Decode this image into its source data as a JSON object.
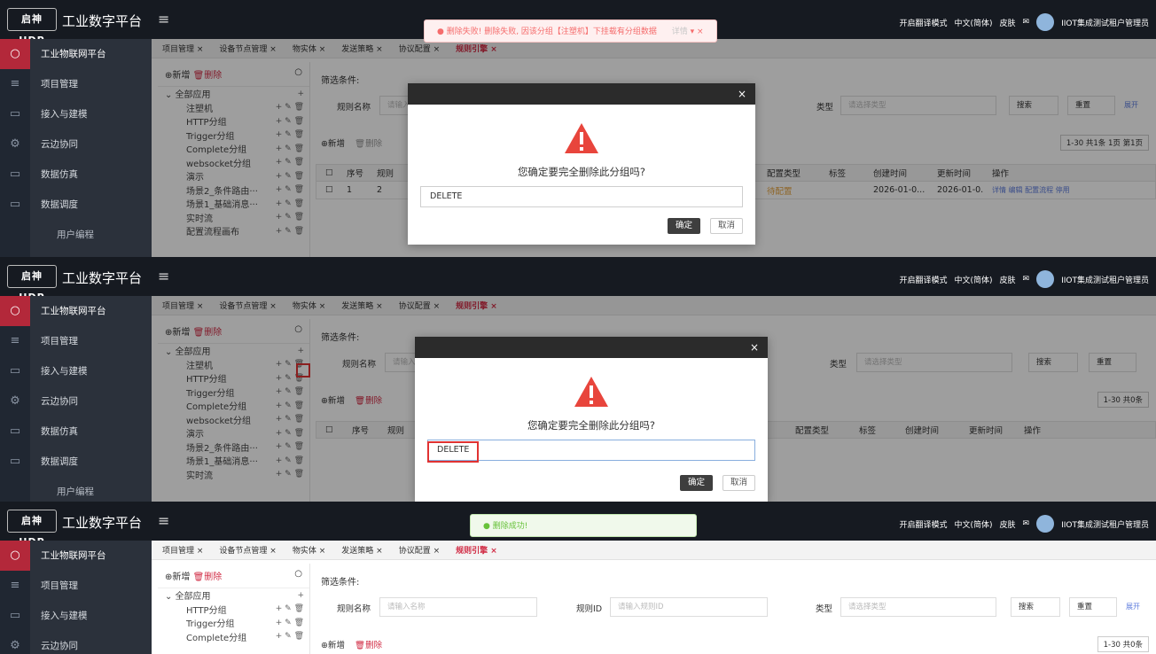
{
  "app": {
    "logo_text": "启神 IIDP",
    "title": "工业数字平台",
    "menu_icon": "hamburger-icon"
  },
  "header_right": {
    "translate_mode": "开启翻译模式",
    "language": "中文(简体)",
    "skin": "皮肤",
    "user": "IIOT集成测试租户管理员"
  },
  "sidebar": {
    "platform": "工业物联网平台",
    "items": [
      "项目管理",
      "接入与建模",
      "云边协同",
      "数据仿真",
      "数据调度"
    ],
    "sub_items": [
      "用户编程"
    ]
  },
  "tabs": [
    "项目管理",
    "设备节点管理",
    "物实体",
    "发送策略",
    "协议配置",
    "规则引擎"
  ],
  "active_tab": "规则引擎",
  "tree": {
    "add": "新增",
    "delete": "删除",
    "root": "全部应用",
    "nodes_before": [
      "注塑机",
      "HTTP分组",
      "Trigger分组",
      "Complete分组",
      "websocket分组",
      "演示",
      "场景2_条件路由···",
      "场景1_基础消息···",
      "实时流",
      "配置流程画布"
    ],
    "nodes_after": [
      "HTTP分组",
      "Trigger分组",
      "Complete分组"
    ]
  },
  "filter": {
    "label": "筛选条件:",
    "rule_name": "规则名称",
    "rule_name_ph": "请输入名称",
    "rule_id": "规则ID",
    "rule_id_ph": "请输入规则ID",
    "type": "类型",
    "type_ph": "请选择类型",
    "search": "搜索",
    "reset": "重置",
    "expand": "展开"
  },
  "actions": {
    "add": "新增",
    "delete": "删除"
  },
  "pager": {
    "p1": "1-30 共1条 1页 第1页",
    "p2": "1-30 共0条",
    "p3": "1-30 共0条"
  },
  "table": {
    "headers": [
      "序号",
      "规则",
      "配置类型",
      "标签",
      "创建时间",
      "更新时间",
      "操作"
    ],
    "row": {
      "no": "1",
      "id": "2",
      "config": "待配置",
      "created": "2026-01-0...",
      "updated": "2026-01-0...",
      "ops": "详情 编辑 配置流程 停用"
    }
  },
  "dialog": {
    "close": "×",
    "message": "您确定要完全删除此分组吗?",
    "input_value": "DELETE",
    "ok": "确定",
    "cancel": "取消"
  },
  "toasts": {
    "error": "删除失败! 删除失败, 因该分组【注塑机】下挂载有分组数据",
    "error_detail": "详情",
    "success": "删除成功!"
  },
  "colors": {
    "accent": "#d12c45",
    "header_bg": "#161a21",
    "sidebar_bg": "#2b313b"
  }
}
